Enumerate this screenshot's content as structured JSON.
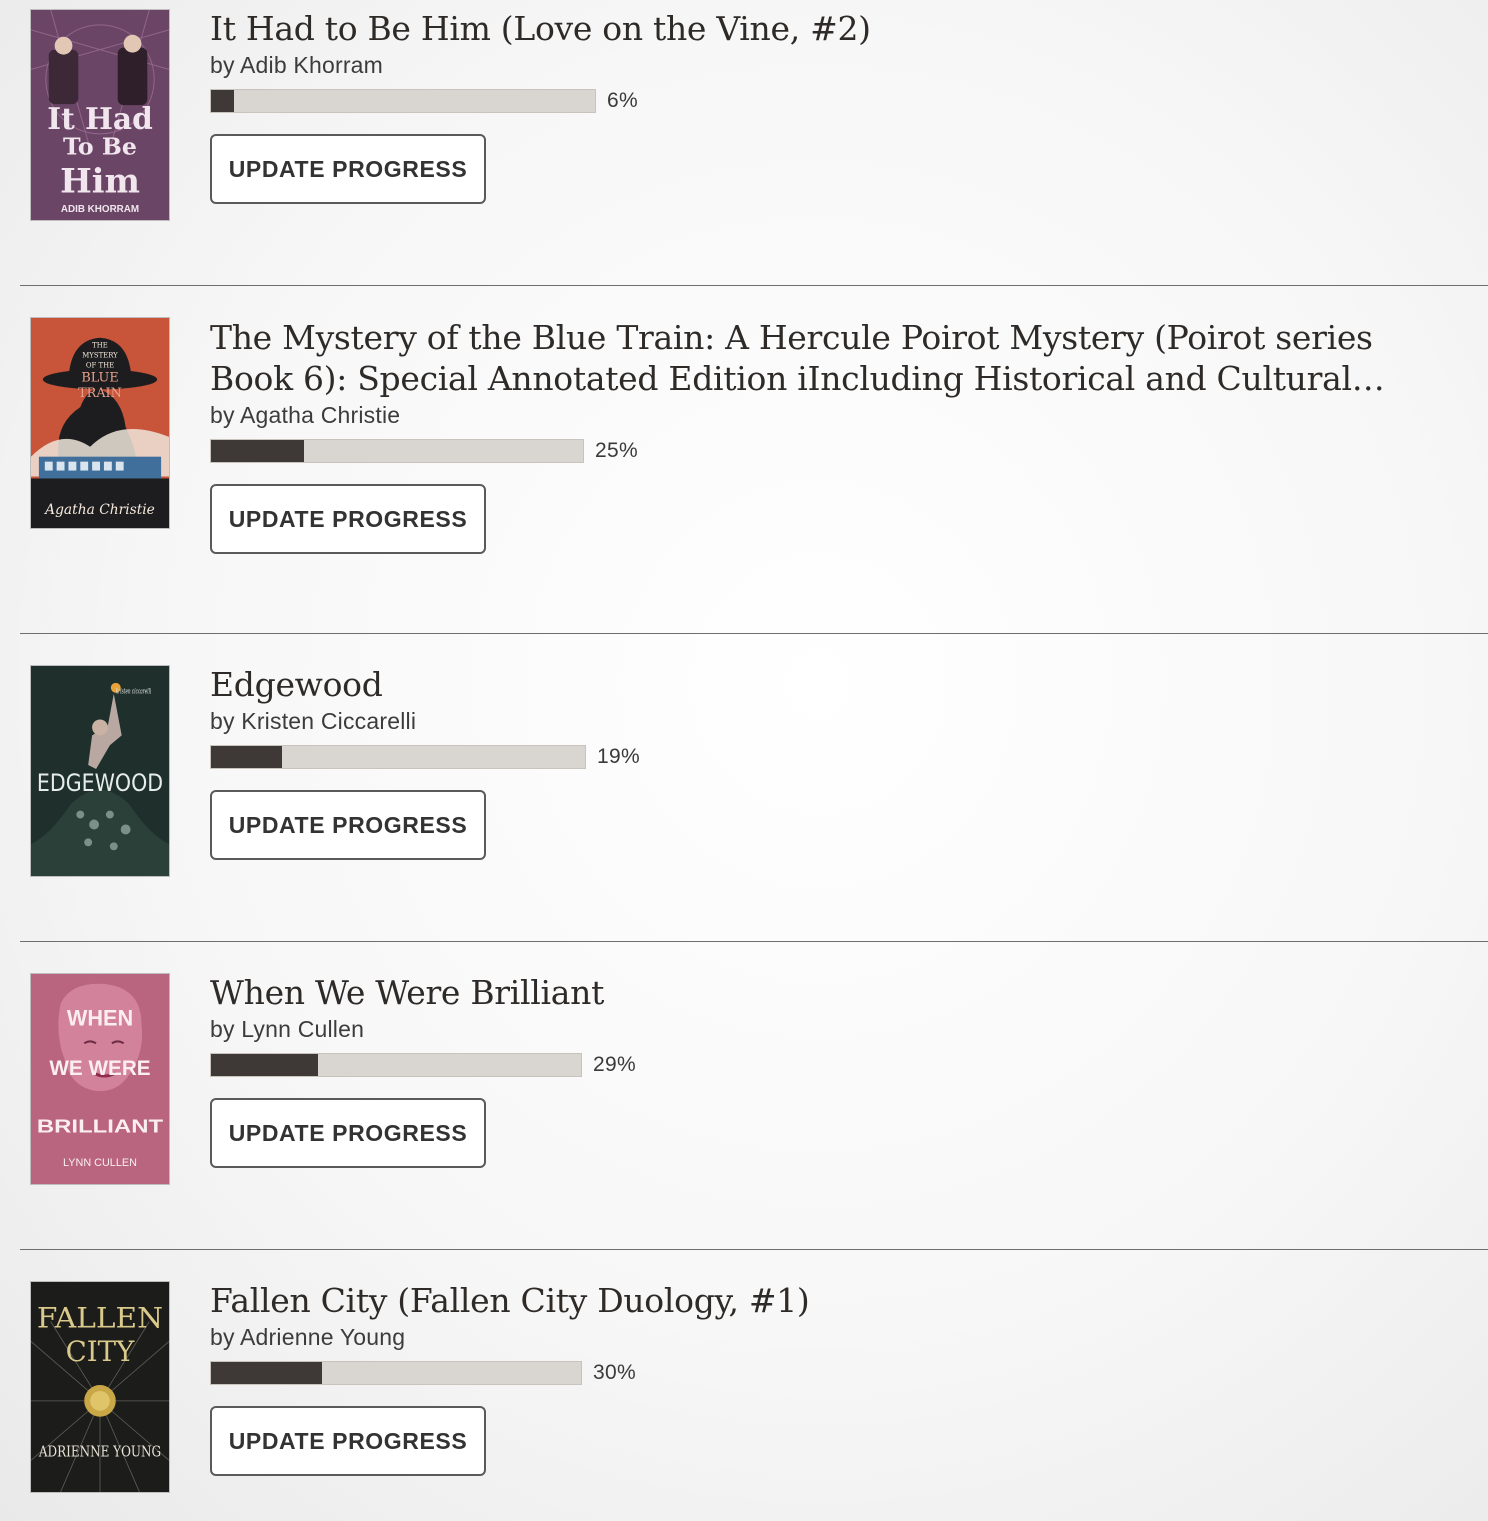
{
  "books": [
    {
      "title": "It Had to Be Him (Love on the Vine, #2)",
      "author": "by Adib Khorram",
      "progress_label": "6%",
      "progress": 0.06,
      "button_label": "UPDATE PROGRESS",
      "cover": {
        "lines": [
          "It Had",
          "To Be",
          "Him"
        ],
        "author": "ADIB KHORRAM",
        "bg": "#6a4566",
        "fg": "#f1e6ee"
      }
    },
    {
      "title": "The Mystery of the Blue Train: A Hercule Poirot Mystery (Poirot series Book 6): Special Annotated Edition iIncluding Historical and Cultural Context and...",
      "author": "by Agatha Christie",
      "progress_label": "25%",
      "progress": 0.25,
      "button_label": "UPDATE PROGRESS",
      "cover": {
        "lines": [
          "THE",
          "MYSTERY",
          "OF THE",
          "BLUE",
          "TRAIN"
        ],
        "author": "Agatha Christie",
        "bg": "#c8553a",
        "fg": "#f4e9dc"
      }
    },
    {
      "title": "Edgewood",
      "author": "by Kristen Ciccarelli",
      "progress_label": "19%",
      "progress": 0.19,
      "button_label": "UPDATE PROGRESS",
      "cover": {
        "lines": [
          "EDGEWOOD"
        ],
        "author": "kristen ciccarelli",
        "bg": "#1f2f2b",
        "fg": "#e6ece9"
      }
    },
    {
      "title": "When We Were Brilliant",
      "author": "by Lynn Cullen",
      "progress_label": "29%",
      "progress": 0.29,
      "button_label": "UPDATE PROGRESS",
      "cover": {
        "lines": [
          "WHEN",
          "WE WERE",
          "BRILLIANT"
        ],
        "author": "LYNN CULLEN",
        "bg": "#b9657f",
        "fg": "#fbeef2"
      }
    },
    {
      "title": "Fallen City (Fallen City Duology, #1)",
      "author": "by Adrienne Young",
      "progress_label": "30%",
      "progress": 0.3,
      "button_label": "UPDATE PROGRESS",
      "cover": {
        "lines": [
          "FALLEN",
          "CITY"
        ],
        "author": "ADRIENNE YOUNG",
        "bg": "#1c1c1a",
        "fg": "#d9c98a"
      }
    }
  ]
}
